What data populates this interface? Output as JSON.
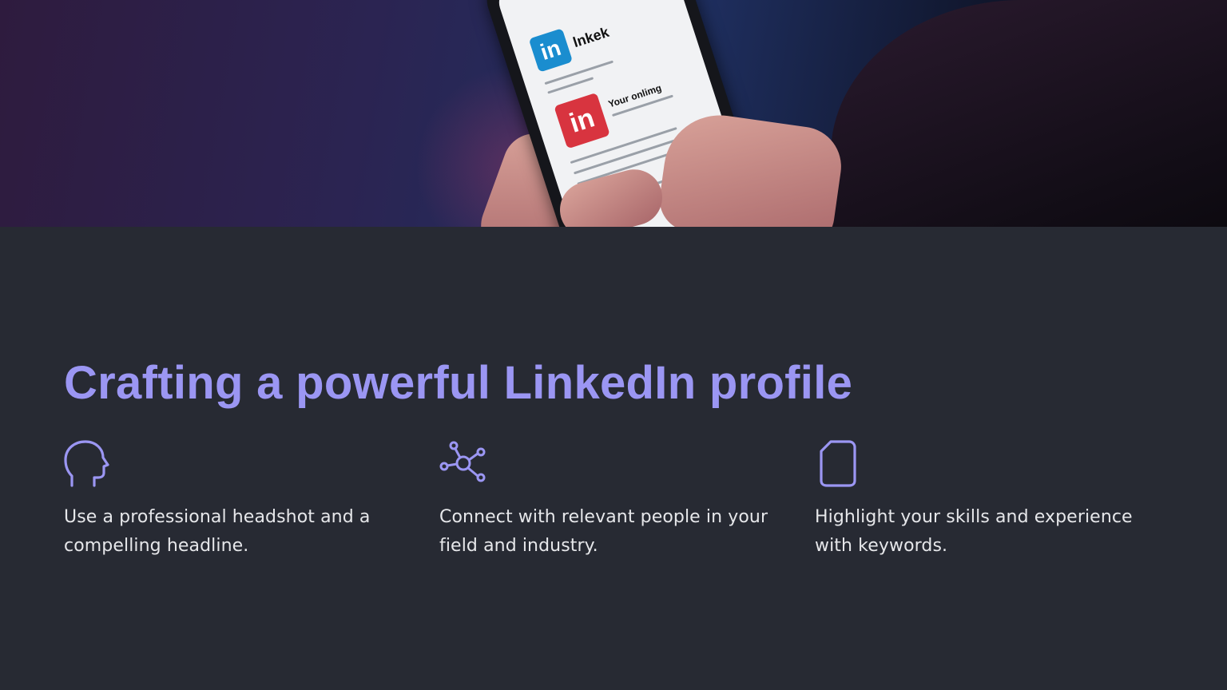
{
  "hero": {
    "image_alt_icon": "phone-linkedin-photo",
    "screen": {
      "app_name": "lnkek",
      "card_title": "Your onlimg"
    }
  },
  "title": "Crafting a powerful LinkedIn profile",
  "features": [
    {
      "icon": "head-profile-icon",
      "text": "Use a professional headshot and a compelling headline."
    },
    {
      "icon": "network-icon",
      "text": "Connect with relevant people in your field and industry."
    },
    {
      "icon": "document-icon",
      "text": "Highlight your skills and experience with keywords."
    }
  ],
  "colors": {
    "accent": "#9b96f3",
    "background": "#272a33",
    "text": "#e6e7ea"
  }
}
